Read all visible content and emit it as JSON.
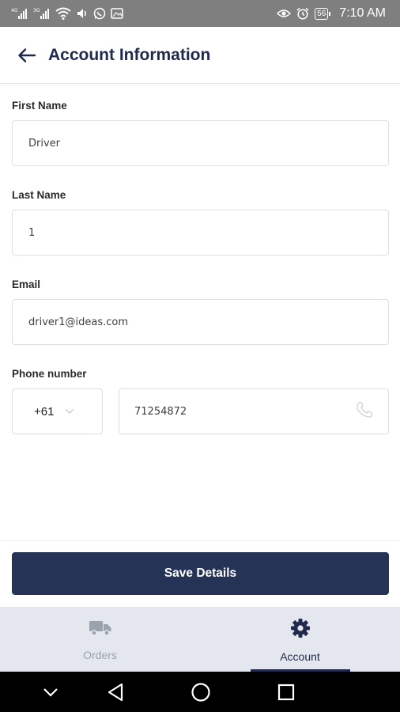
{
  "status_bar": {
    "time": "7:10 AM",
    "battery": "56",
    "left_icons": [
      "signal-4g-icon",
      "signal-3g-icon",
      "wifi-icon",
      "volume-icon",
      "whatsapp-icon",
      "gallery-icon"
    ],
    "right_icons": [
      "eye-icon",
      "alarm-icon",
      "battery-icon"
    ]
  },
  "header": {
    "title": "Account Information"
  },
  "form": {
    "first_name": {
      "label": "First Name",
      "value": "Driver"
    },
    "last_name": {
      "label": "Last Name",
      "value": "1"
    },
    "email": {
      "label": "Email",
      "value": "driver1@ideas.com"
    },
    "phone": {
      "label": "Phone number",
      "country_code": "+61",
      "value": "71254872"
    }
  },
  "save_label": "Save Details",
  "tabs": [
    {
      "label": "Orders",
      "icon": "truck-icon",
      "active": false
    },
    {
      "label": "Account",
      "icon": "gear-icon",
      "active": true
    }
  ],
  "colors": {
    "primary": "#253357",
    "title": "#1f2a4d",
    "inactive_tab": "#9aa2ad",
    "tab_bar_bg": "#e4e8ee"
  }
}
